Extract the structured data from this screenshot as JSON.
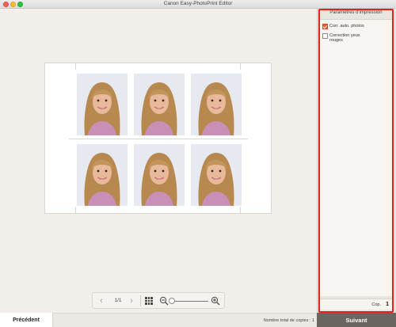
{
  "window": {
    "title": "Canon Easy-PhotoPrint Editor"
  },
  "navigator": {
    "page_indicator": "1/1"
  },
  "panel": {
    "header": "Paramètres d'impression",
    "options": [
      {
        "label_lines": [
          "Corr. auto. photos"
        ],
        "checked": true
      },
      {
        "label_lines": [
          "Correction yeux",
          "rouges"
        ],
        "checked": false
      }
    ],
    "copies_label": "Cop.",
    "copies_value": "1"
  },
  "footer": {
    "prev_label": "Précédent",
    "total_copies": "Nombre total de copies : 1",
    "next_label": "Suivant"
  },
  "colors": {
    "highlight_border": "#e2231a",
    "checkbox_checked": "#e8602c",
    "next_button": "#6a655e"
  },
  "photos": {
    "count": 6,
    "layout": "2 rows x 3 columns",
    "subject": "portrait"
  }
}
